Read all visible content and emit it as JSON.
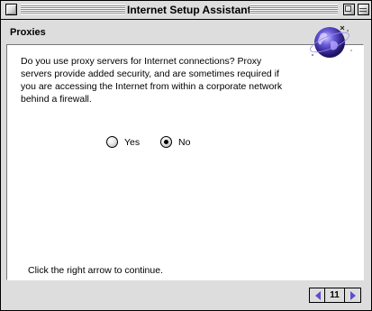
{
  "window": {
    "title": "Internet Setup Assistant"
  },
  "section": {
    "title": "Proxies",
    "question": "Do you use proxy servers for Internet connections?  Proxy servers provide added security, and are sometimes required if you are accessing the Internet from within a corporate network behind a firewall."
  },
  "options": {
    "yes_label": "Yes",
    "no_label": "No",
    "selected": "No"
  },
  "instruction": "Click the right arrow to continue.",
  "navigation": {
    "page": "11",
    "arrow_color": "#5b4fd0"
  },
  "icons": {
    "logo": "globe-icon"
  }
}
